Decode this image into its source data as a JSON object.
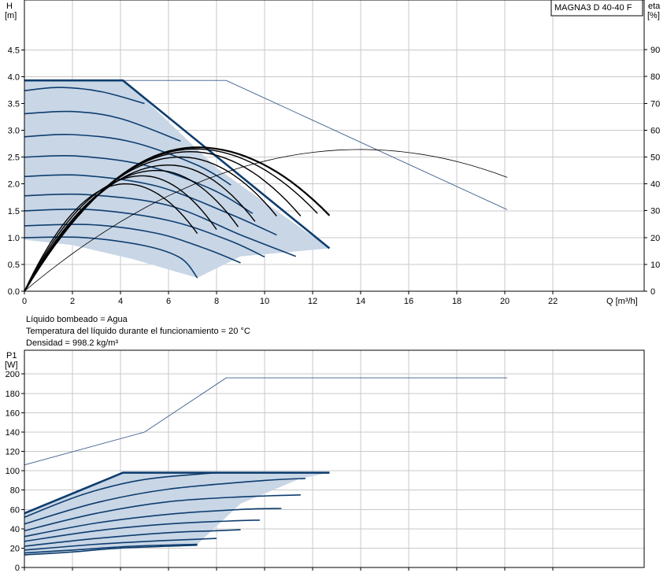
{
  "model_label": "MAGNA3 D 40-40 F",
  "info": [
    "Líquido bombeado = Agua",
    "Temperatura del líquido durante el funcionamiento = 20 °C",
    "Densidad = 998.2 kg/m³"
  ],
  "colors": {
    "curve_dark": "#0e3d6e",
    "curve_thin": "#3b5b8c",
    "area_fill": "#c8d6e6",
    "efficiency": "#000000",
    "grid": "#c8c8c8"
  },
  "chart_data": [
    {
      "type": "line",
      "name": "head-efficiency",
      "x_axis": {
        "label": "Q [m³/h]",
        "range": [
          0,
          25.8
        ],
        "ticks": [
          0,
          2,
          4,
          6,
          8,
          10,
          12,
          14,
          16,
          18,
          20,
          22
        ]
      },
      "y_axis": {
        "label_top": "H",
        "label_bottom": "[m]",
        "range": [
          0,
          5.43
        ],
        "ticks": [
          0.0,
          0.5,
          1.0,
          1.5,
          2.0,
          2.5,
          3.0,
          3.5,
          4.0,
          4.5
        ]
      },
      "y2_axis": {
        "label_top": "eta",
        "label_bottom": "[%]",
        "range": [
          0,
          108.5
        ],
        "ticks": [
          0,
          10,
          20,
          30,
          40,
          50,
          60,
          70,
          80,
          90
        ]
      },
      "grid": true,
      "operating_area": [
        [
          0,
          3.93
        ],
        [
          4.1,
          3.93
        ],
        [
          5.2,
          3.5
        ],
        [
          8.0,
          2.3
        ],
        [
          10.5,
          1.5
        ],
        [
          12.7,
          0.8
        ],
        [
          11.5,
          0.75
        ],
        [
          9.0,
          0.65
        ],
        [
          7.2,
          0.25
        ],
        [
          4.5,
          0.6
        ],
        [
          2.0,
          0.86
        ],
        [
          0,
          0.96
        ]
      ],
      "head_curves": [
        {
          "points": [
            [
              0,
              3.93
            ],
            [
              4.1,
              3.93
            ],
            [
              12.7,
              0.8
            ]
          ]
        },
        {
          "points": [
            [
              0,
              3.74
            ],
            [
              1.5,
              3.8
            ],
            [
              3.2,
              3.72
            ],
            [
              5.0,
              3.5
            ]
          ]
        },
        {
          "points": [
            [
              0,
              3.31
            ],
            [
              2.0,
              3.35
            ],
            [
              4.0,
              3.22
            ],
            [
              6.5,
              2.8
            ]
          ]
        },
        {
          "points": [
            [
              0,
              2.88
            ],
            [
              2.0,
              2.92
            ],
            [
              4.5,
              2.78
            ],
            [
              7.2,
              2.35
            ],
            [
              8.6,
              1.98
            ]
          ]
        },
        {
          "points": [
            [
              0,
              2.5
            ],
            [
              2.2,
              2.52
            ],
            [
              5.0,
              2.35
            ],
            [
              7.8,
              1.9
            ],
            [
              9.5,
              1.45
            ]
          ]
        },
        {
          "points": [
            [
              0,
              2.14
            ],
            [
              2.4,
              2.16
            ],
            [
              5.5,
              1.96
            ],
            [
              8.5,
              1.45
            ],
            [
              10.5,
              1.05
            ]
          ]
        },
        {
          "points": [
            [
              0,
              1.78
            ],
            [
              2.6,
              1.8
            ],
            [
              6.0,
              1.6
            ],
            [
              9.0,
              1.05
            ],
            [
              11.3,
              0.65
            ]
          ]
        },
        {
          "points": [
            [
              0,
              1.5
            ],
            [
              2.8,
              1.52
            ],
            [
              6.0,
              1.32
            ],
            [
              8.5,
              0.95
            ],
            [
              10.0,
              0.64
            ]
          ]
        },
        {
          "points": [
            [
              0,
              1.22
            ],
            [
              2.8,
              1.24
            ],
            [
              5.5,
              1.08
            ],
            [
              7.5,
              0.8
            ],
            [
              9.0,
              0.53
            ]
          ]
        },
        {
          "points": [
            [
              0,
              1.0
            ],
            [
              2.5,
              1.0
            ],
            [
              5.0,
              0.85
            ],
            [
              6.5,
              0.62
            ],
            [
              7.2,
              0.25
            ]
          ]
        }
      ],
      "max_curve_thin": {
        "points": [
          [
            0,
            3.93
          ],
          [
            8.4,
            3.93
          ],
          [
            20.1,
            1.52
          ]
        ]
      },
      "efficiency_curves": [
        {
          "peak": [
            7.2,
            53.6
          ],
          "end": [
            12.7,
            28.2
          ],
          "width": 2.2
        },
        {
          "peak": [
            7.1,
            53.0
          ],
          "end": [
            12.2,
            29.0
          ],
          "width": 1.4
        },
        {
          "peak": [
            6.9,
            52.0
          ],
          "end": [
            11.5,
            28.0
          ],
          "width": 1.4
        },
        {
          "peak": [
            6.5,
            50.0
          ],
          "end": [
            10.5,
            28.0
          ],
          "width": 1.4
        },
        {
          "peak": [
            6.0,
            47.0
          ],
          "end": [
            9.6,
            26.0
          ],
          "width": 1.4
        },
        {
          "peak": [
            5.5,
            45.0
          ],
          "end": [
            8.9,
            24.0
          ],
          "width": 1.4
        },
        {
          "peak": [
            4.9,
            43.0
          ],
          "end": [
            8.0,
            23.0
          ],
          "width": 1.4
        },
        {
          "peak": [
            4.2,
            40.0
          ],
          "end": [
            7.2,
            21.5
          ],
          "width": 1.4
        }
      ],
      "efficiency_thin": {
        "peak": [
          14.0,
          52.8
        ],
        "end": [
          20.1,
          42.4
        ]
      }
    },
    {
      "type": "line",
      "name": "power",
      "y_axis": {
        "label_top": "P1",
        "label_bottom": "[W]",
        "range": [
          0,
          224.6
        ],
        "ticks": [
          0,
          20,
          40,
          60,
          80,
          100,
          120,
          140,
          160,
          180,
          200
        ]
      },
      "x_range": [
        0,
        25.8
      ],
      "grid": true,
      "operating_area": [
        [
          0,
          56
        ],
        [
          4.1,
          98
        ],
        [
          12.7,
          98
        ],
        [
          11.5,
          92
        ],
        [
          9.0,
          66
        ],
        [
          7.2,
          24
        ],
        [
          4.5,
          22
        ],
        [
          2.0,
          17
        ],
        [
          0,
          13
        ]
      ],
      "power_curves": [
        {
          "points": [
            [
              0,
              56
            ],
            [
              4.1,
              98
            ],
            [
              12.7,
              98
            ]
          ]
        },
        {
          "points": [
            [
              0,
              52
            ],
            [
              2.5,
              76
            ],
            [
              5.0,
              91
            ],
            [
              8.0,
              98
            ]
          ]
        },
        {
          "points": [
            [
              0,
              45
            ],
            [
              3.0,
              67
            ],
            [
              6.0,
              81
            ],
            [
              10.0,
              90
            ],
            [
              11.7,
              92
            ]
          ]
        },
        {
          "points": [
            [
              0,
              38
            ],
            [
              3.0,
              56
            ],
            [
              6.0,
              68
            ],
            [
              9.0,
              73
            ],
            [
              11.5,
              75
            ]
          ]
        },
        {
          "points": [
            [
              0,
              32
            ],
            [
              3.0,
              46
            ],
            [
              6.0,
              55
            ],
            [
              9.0,
              60
            ],
            [
              10.7,
              61
            ]
          ]
        },
        {
          "points": [
            [
              0,
              27
            ],
            [
              3.0,
              38
            ],
            [
              6.0,
              45
            ],
            [
              8.5,
              48
            ],
            [
              9.8,
              49
            ]
          ]
        },
        {
          "points": [
            [
              0,
              22
            ],
            [
              3.0,
              30
            ],
            [
              6.0,
              36
            ],
            [
              8.0,
              38
            ],
            [
              9.0,
              39
            ]
          ]
        },
        {
          "points": [
            [
              0,
              18
            ],
            [
              3.0,
              24
            ],
            [
              6.0,
              28
            ],
            [
              8.0,
              30
            ]
          ]
        },
        {
          "points": [
            [
              0,
              15
            ],
            [
              2.0,
              18
            ],
            [
              4.5,
              22
            ],
            [
              7.2,
              24
            ]
          ]
        },
        {
          "points": [
            [
              0,
              13
            ],
            [
              2.0,
              16
            ],
            [
              4.0,
              20
            ],
            [
              7.2,
              23
            ]
          ]
        }
      ],
      "max_power_thin": {
        "points": [
          [
            0,
            106
          ],
          [
            5.0,
            140
          ],
          [
            8.4,
            196
          ],
          [
            20.1,
            196
          ]
        ]
      }
    }
  ]
}
